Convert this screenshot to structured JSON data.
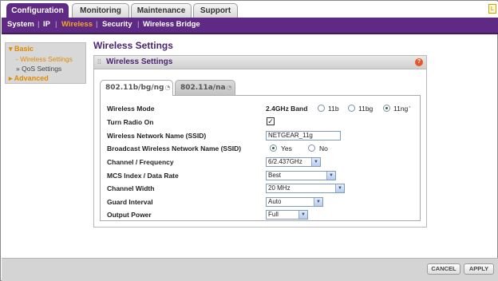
{
  "top_tabs": [
    {
      "label": "Configuration",
      "active": true
    },
    {
      "label": "Monitoring",
      "active": false
    },
    {
      "label": "Maintenance",
      "active": false
    },
    {
      "label": "Support",
      "active": false
    }
  ],
  "sub_nav": {
    "items": [
      "System",
      "IP",
      "Wireless",
      "Security",
      "Wireless Bridge"
    ],
    "active": "Wireless"
  },
  "sidebar": {
    "basic_label": "▾ Basic",
    "links": [
      "- Wireless Settings",
      "» QoS Settings"
    ],
    "advanced_label": "▸ Advanced"
  },
  "page_title": "Wireless Settings",
  "panel_title": "Wireless Settings",
  "inner_tabs": [
    {
      "label": "802.11b/bg/ng",
      "active": true
    },
    {
      "label": "802.11a/na",
      "active": false
    }
  ],
  "form": {
    "wireless_mode": {
      "label": "Wireless Mode",
      "band": "2.4GHz Band",
      "options": [
        "11b",
        "11bg",
        "11ng"
      ],
      "selected": "11ng"
    },
    "turn_radio_on": {
      "label": "Turn Radio On",
      "checked": true,
      "check_mark": "✓"
    },
    "ssid": {
      "label": "Wireless Network Name (SSID)",
      "value": "NETGEAR_11g"
    },
    "broadcast_ssid": {
      "label": "Broadcast Wireless Network Name (SSID)",
      "options": [
        "Yes",
        "No"
      ],
      "selected": "Yes"
    },
    "channel": {
      "label": "Channel / Frequency",
      "value": "6/2.437GHz"
    },
    "mcs": {
      "label": "MCS Index / Data Rate",
      "value": "Best"
    },
    "channel_width": {
      "label": "Channel Width",
      "value": "20 MHz"
    },
    "guard_interval": {
      "label": "Guard Interval",
      "value": "Auto"
    },
    "output_power": {
      "label": "Output Power",
      "value": "Full"
    }
  },
  "buttons": {
    "cancel": "CANCEL",
    "apply": "APPLY"
  },
  "icons": {
    "help": "?",
    "dropdown": "▼",
    "wifi": "wifi-icon"
  },
  "colors": {
    "brand_purple": "#5e2a84",
    "active_orange": "#f5a623",
    "title_purple": "#4a2470"
  }
}
